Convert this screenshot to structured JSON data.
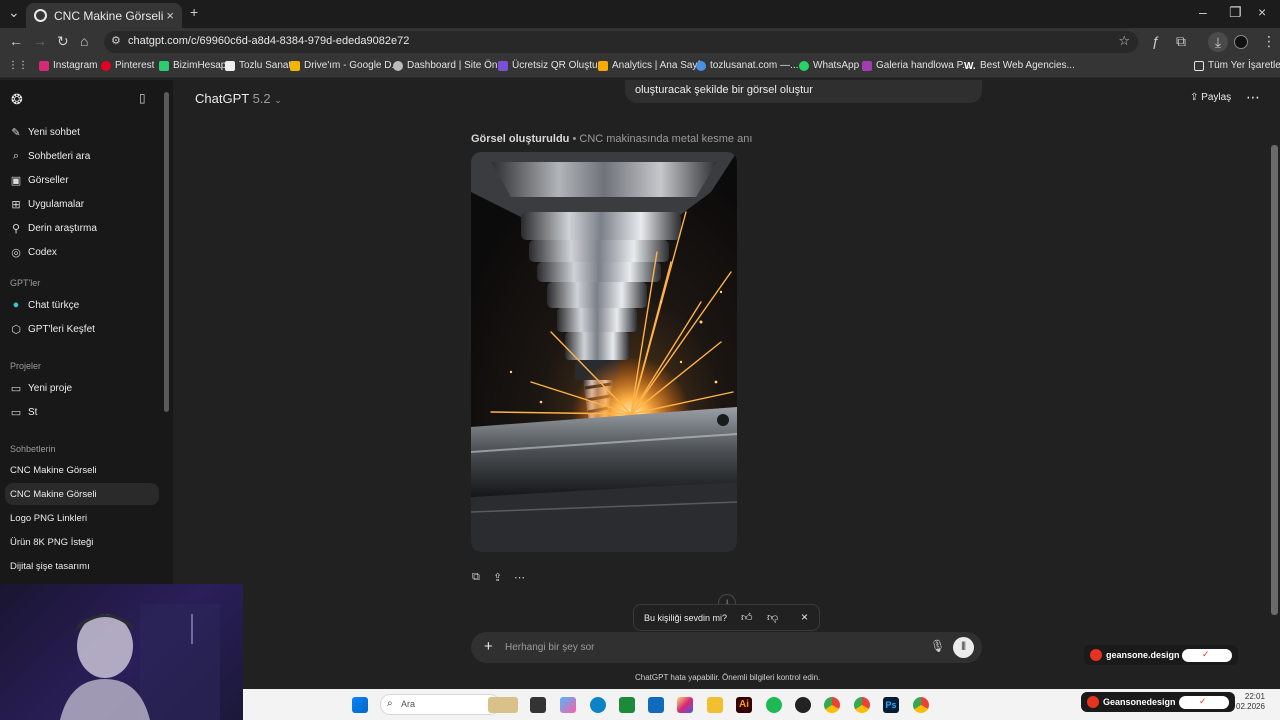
{
  "browser": {
    "tab_title": "CNC Makine Görseli",
    "url": "chatgpt.com/c/69960c6d-a8d4-8384-979d-ededa9082e72",
    "new_tab": "+",
    "bookmarks": [
      "Instagram",
      "Pinterest",
      "BizimHesap",
      "Tozlu Sanat",
      "Drive'ım - Google D...",
      "Dashboard | Site Ön...",
      "Ücretsiz QR Oluştur...",
      "Analytics | Ana Sayfa",
      "tozlusanat.com —...",
      "WhatsApp",
      "Galeria handlowa P...",
      "Best Web Agencies..."
    ],
    "all_bookmarks": "Tüm Yer İşaretleri"
  },
  "sidebar": {
    "items": [
      "Yeni sohbet",
      "Sohbetleri ara",
      "Görseller",
      "Uygulamalar",
      "Derin araştırma",
      "Codex"
    ],
    "gpts_heading": "GPT'ler",
    "gpts": [
      "Chat türkçe",
      "GPT'leri Keşfet"
    ],
    "projects_heading": "Projeler",
    "projects": [
      "Yeni proje",
      "St"
    ],
    "chats_heading": "Sohbetlerin",
    "chats": [
      "CNC Makine Görseli",
      "CNC Makine Görseli",
      "Logo PNG Linkleri",
      "Ürün 8K PNG İsteği",
      "Dijital şişe tasarımı"
    ]
  },
  "main": {
    "model": "ChatGPT",
    "model_version": "5.2",
    "share_label": "Paylaş",
    "prev_message": "oluşturacak şekilde bir görsel oluştur",
    "gen_label_bold": "Görsel oluşturuldu",
    "gen_label_rest": " • CNC makinasında metal kesme anı",
    "feedback_text": "Bu kişiliği sevdin mi?",
    "composer_placeholder": "Herhangi bir şey sor",
    "disclaimer": "ChatGPT hata yapabilir. Önemli bilgileri kontrol edin."
  },
  "taskbar": {
    "search_label": "Ara",
    "time": "22:01",
    "date": "02.2026"
  },
  "overlay": {
    "badge_1": "geansone.design",
    "badge_2": "Geansonedesign"
  },
  "colors": {
    "accent_red": "#e5331f",
    "sidebar_bg": "#181818",
    "main_bg": "#212121"
  }
}
